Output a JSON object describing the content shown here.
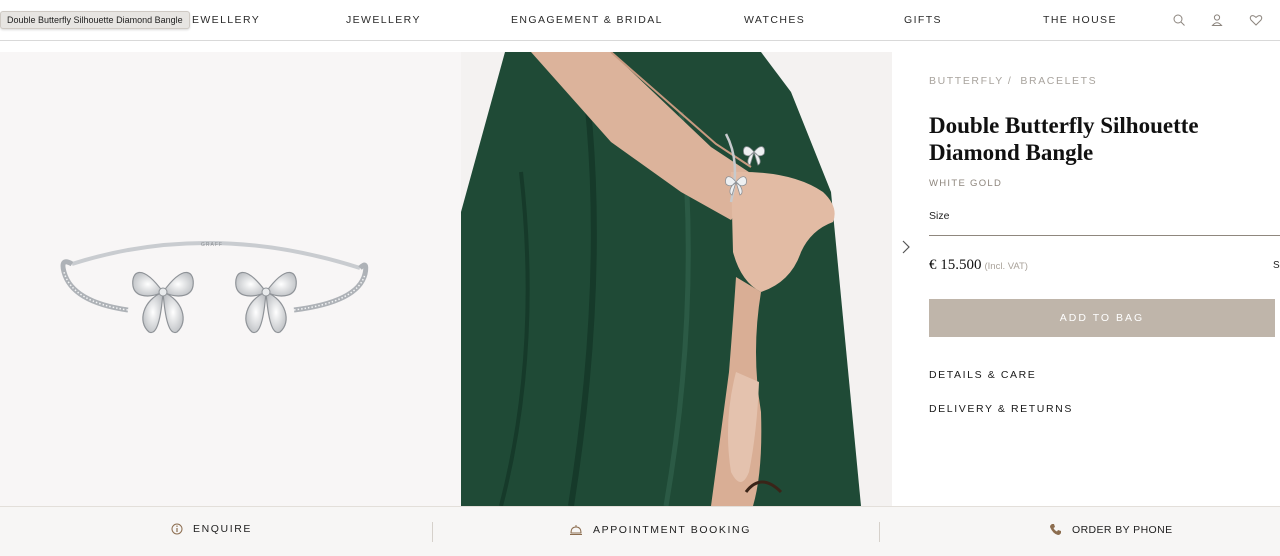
{
  "tooltip": {
    "text": "Double Butterfly Silhouette Diamond Bangle"
  },
  "nav": {
    "items": [
      {
        "label": "H JEWELLERY"
      },
      {
        "label": "JEWELLERY"
      },
      {
        "label": "ENGAGEMENT & BRIDAL"
      },
      {
        "label": "WATCHES"
      },
      {
        "label": "GIFTS"
      },
      {
        "label": "THE HOUSE"
      }
    ],
    "icons": [
      "search-icon",
      "account-icon",
      "wishlist-heart-icon"
    ]
  },
  "gallery": {
    "images": [
      "bangle-product-image",
      "model-wearing-bangle-image"
    ],
    "brand_engraving": "GRAFF"
  },
  "product": {
    "breadcrumb": [
      "BUTTERFLY",
      "BRACELETS"
    ],
    "breadcrumb_separator": "/",
    "title": "Double Butterfly Silhouette Diamond Bangle",
    "metal": "WHITE GOLD",
    "size_label": "Size",
    "price": "€ 15.500",
    "vat": "(Incl. VAT)",
    "size_guide": "Si",
    "add_to_bag": "ADD TO BAG",
    "accordions": [
      "DETAILS & CARE",
      "DELIVERY & RETURNS"
    ]
  },
  "bottom_bar": {
    "enquire": "ENQUIRE",
    "appointment": "APPOINTMENT BOOKING",
    "order_by_phone": "ORDER BY PHONE"
  },
  "colors": {
    "button": "#bfb5aa",
    "muted_text": "#a8a39d",
    "dress_green": "#1f4a36",
    "background": "#f8f6f6"
  }
}
